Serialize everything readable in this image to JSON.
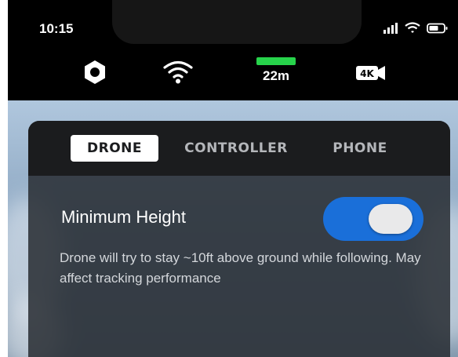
{
  "status_bar": {
    "time": "10:15",
    "signal_icon": "cellular-signal-icon",
    "wifi_icon": "wifi-icon",
    "battery_icon": "battery-icon"
  },
  "toolbar": {
    "settings_icon": "gear-icon",
    "connection_icon": "wifi-icon",
    "altitude": "22m",
    "altitude_color": "#27d34b",
    "video_icon": "4k-camera-icon",
    "video_label": "4K"
  },
  "tabs": [
    {
      "label": "DRONE",
      "active": true
    },
    {
      "label": "CONTROLLER",
      "active": false
    },
    {
      "label": "PHONE",
      "active": false
    }
  ],
  "setting": {
    "title": "Minimum Height",
    "enabled": true,
    "toggle_color": "#1a6fd9",
    "description": "Drone will try to stay ~10ft above ground while following.  May affect tracking performance"
  }
}
